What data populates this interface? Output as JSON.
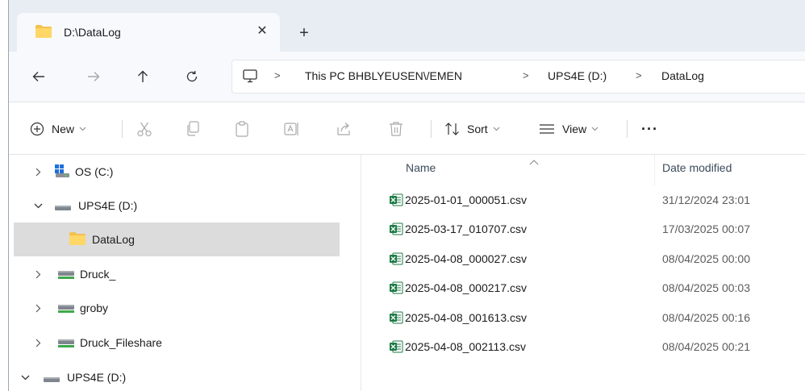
{
  "tab": {
    "title": "D:\\DataLog",
    "close": "✕",
    "new_tab": "+"
  },
  "breadcrumb": {
    "items": [
      "This PC BHBL\u0019̙̣̃̃̕",
      "UPS4E (D:)",
      "DataLog"
    ],
    "pc_label": "This PC BHBLYEUSEN\\/EMEN",
    "drive_label": "UPS4E (D:)",
    "folder_label": "DataLog",
    "separator": ">"
  },
  "toolbar": {
    "new_label": "New",
    "sort_label": "Sort",
    "view_label": "View",
    "more_label": "···"
  },
  "sidebar": {
    "items": [
      {
        "label": "OS (C:)",
        "icon": "windows-drive-icon",
        "expanded": false
      },
      {
        "label": "UPS4E (D:)",
        "icon": "drive-icon",
        "expanded": true
      },
      {
        "label": "DataLog",
        "icon": "folder-icon",
        "selected": true
      },
      {
        "label": "Druck_",
        "icon": "network-drive-icon",
        "expanded": false
      },
      {
        "label": "groby",
        "icon": "network-drive-icon",
        "expanded": false
      },
      {
        "label": "Druck_Fileshare",
        "icon": "network-drive-icon",
        "expanded": false
      },
      {
        "label": "UPS4E (D:)",
        "icon": "drive-icon",
        "expanded": true
      }
    ]
  },
  "columns": {
    "name": "Name",
    "date": "Date modified"
  },
  "files": [
    {
      "name": "2025-01-01_000051.csv",
      "date": "31/12/2024 23:01"
    },
    {
      "name": "2025-03-17_010707.csv",
      "date": "17/03/2025 00:07"
    },
    {
      "name": "2025-04-08_000027.csv",
      "date": "08/04/2025 00:00"
    },
    {
      "name": "2025-04-08_000217.csv",
      "date": "08/04/2025 00:03"
    },
    {
      "name": "2025-04-08_001613.csv",
      "date": "08/04/2025 00:16"
    },
    {
      "name": "2025-04-08_002113.csv",
      "date": "08/04/2025 00:21"
    }
  ],
  "colors": {
    "accent": "#1e6fd9",
    "folder": "#f4c14f",
    "excel": "#1d7a45",
    "selected": "#dcdcdc"
  }
}
